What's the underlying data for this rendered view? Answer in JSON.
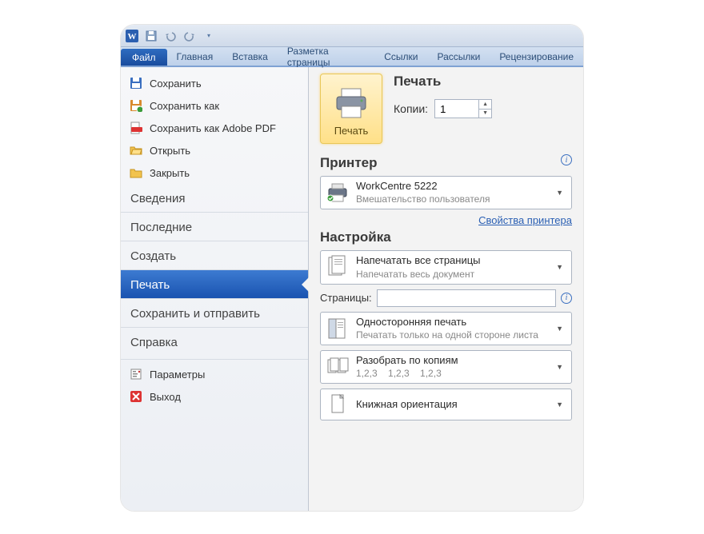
{
  "ribbon": {
    "tabs": [
      "Файл",
      "Главная",
      "Вставка",
      "Разметка страницы",
      "Ссылки",
      "Рассылки",
      "Рецензирование"
    ],
    "activeIndex": 0
  },
  "left": {
    "quick": [
      {
        "label": "Сохранить",
        "icon": "save"
      },
      {
        "label": "Сохранить как",
        "icon": "saveas"
      },
      {
        "label": "Сохранить как Adobe PDF",
        "icon": "pdf"
      },
      {
        "label": "Открыть",
        "icon": "folder-open"
      },
      {
        "label": "Закрыть",
        "icon": "folder-close"
      }
    ],
    "sections": [
      {
        "label": "Сведения",
        "selected": false
      },
      {
        "label": "Последние",
        "selected": false
      },
      {
        "label": "Создать",
        "selected": false
      },
      {
        "label": "Печать",
        "selected": true
      },
      {
        "label": "Сохранить и отправить",
        "selected": false
      },
      {
        "label": "Справка",
        "selected": false
      }
    ],
    "bottom": [
      {
        "label": "Параметры",
        "icon": "options"
      },
      {
        "label": "Выход",
        "icon": "exit"
      }
    ]
  },
  "print": {
    "headerTitle": "Печать",
    "buttonLabel": "Печать",
    "copiesLabel": "Копии:",
    "copiesValue": "1",
    "printerSection": "Принтер",
    "printerName": "WorkCentre 5222",
    "printerStatus": "Вмешательство пользователя",
    "printerPropsLink": "Свойства принтера",
    "settingsSection": "Настройка",
    "pagesLabel": "Страницы:",
    "pagesValue": "",
    "settings": [
      {
        "primary": "Напечатать все страницы",
        "secondary": "Напечатать весь документ",
        "icon": "pages-all"
      },
      {
        "primary": "Односторонняя печать",
        "secondary": "Печатать только на одной стороне листа",
        "icon": "one-side"
      },
      {
        "primary": "Разобрать по копиям",
        "secondary": "1,2,3    1,2,3    1,2,3",
        "icon": "collate"
      },
      {
        "primary": "Книжная ориентация",
        "secondary": "",
        "icon": "portrait"
      }
    ]
  }
}
